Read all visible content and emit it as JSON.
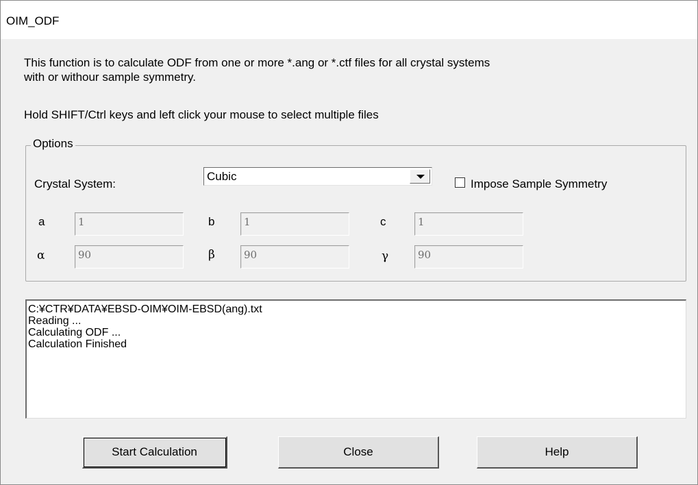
{
  "window": {
    "title": "OIM_ODF"
  },
  "description": {
    "line1": "This function is to calculate ODF from one or more *.ang or *.ctf files for all crystal systems",
    "line2": "with or withour sample symmetry.",
    "hint": "Hold SHIFT/Ctrl keys and left click your mouse to select multiple files"
  },
  "options": {
    "legend": "Options",
    "crystal_system_label": "Crystal System:",
    "crystal_system_value": "Cubic",
    "impose_symmetry_label": "Impose Sample Symmetry",
    "impose_symmetry_checked": false,
    "params": {
      "a_label": "a",
      "a_value": "1",
      "b_label": "b",
      "b_value": "1",
      "c_label": "c",
      "c_value": "1",
      "alpha_label": "α",
      "alpha_value": "90",
      "beta_label": "β",
      "beta_value": "90",
      "gamma_label": "γ",
      "gamma_value": "90"
    }
  },
  "log": {
    "lines": [
      "C:¥CTR¥DATA¥EBSD-OIM¥OIM-EBSD(ang).txt",
      "Reading ...",
      "Calculating ODF ...",
      "Calculation Finished"
    ]
  },
  "buttons": {
    "start_label": "Start  Calculation",
    "close_label": "Close",
    "help_label": "Help"
  }
}
